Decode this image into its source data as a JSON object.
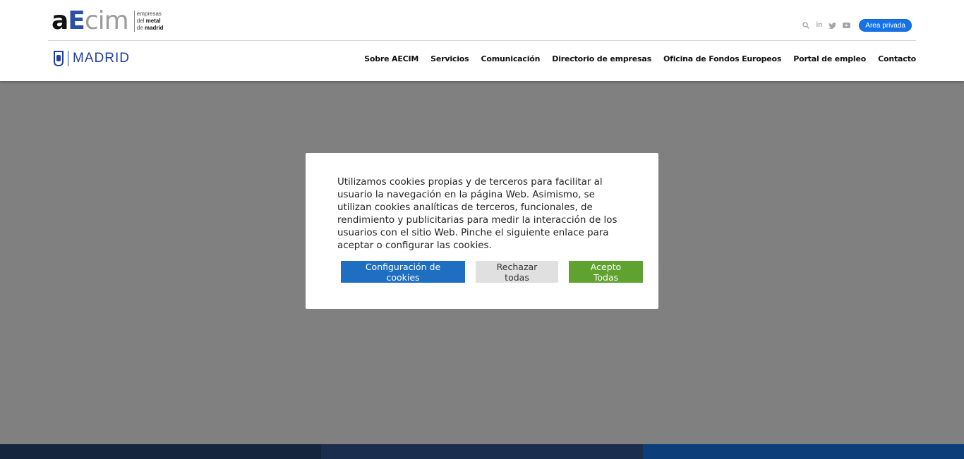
{
  "header": {
    "logo": {
      "mark_a": "a",
      "mark_e": "E",
      "mark_cim": "cim",
      "tag_line1": "empresas",
      "tag_line2_prefix": "del ",
      "tag_line2_bold": "metal",
      "tag_line3_prefix": "de ",
      "tag_line3_bold": "madrid"
    },
    "tools": {
      "search_icon": "search-icon",
      "linkedin_label": "in",
      "twitter_icon": "twitter-icon",
      "youtube_icon": "youtube-icon",
      "area_privada": "Area privada"
    },
    "partner": {
      "name": "MADRID"
    },
    "nav": [
      "Sobre AECIM",
      "Servicios",
      "Comunicación",
      "Directorio de empresas",
      "Oficina de Fondos Europeos",
      "Portal de empleo",
      "Contacto"
    ]
  },
  "cookie_modal": {
    "text": "Utilizamos cookies propias y de terceros para facilitar al usuario la navegación en la página Web. Asimismo, se utilizan cookies analíticas de terceros, funcionales, de rendimiento y publicitarias para medir la interacción de los usuarios con el sitio Web. Pinche el siguiente enlace para aceptar o configurar las cookies.",
    "buttons": {
      "config": "Configuración de cookies",
      "reject": "Rechazar todas",
      "accept": "Acepto Todas"
    }
  },
  "colors": {
    "accent_blue": "#1572e8",
    "config_button": "#1e6fc1",
    "accept_button": "#5fa22f",
    "overlay": "#808080"
  }
}
